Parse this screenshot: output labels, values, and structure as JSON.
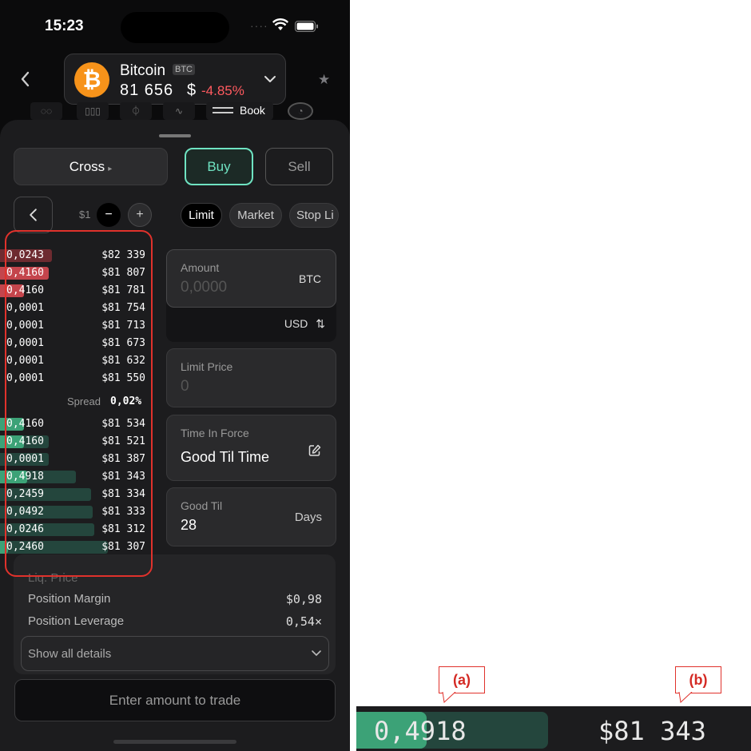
{
  "status": {
    "time": "15:23"
  },
  "coin": {
    "name": "Bitcoin",
    "symbol": "BTC",
    "price": "81 656",
    "currency": "$",
    "change": "-4.85%",
    "logo_glyph": "₿",
    "logo_color": "#f7931a"
  },
  "tabs": {
    "book_label": "Book"
  },
  "trade": {
    "margin_mode": "Cross",
    "buy_label": "Buy",
    "sell_label": "Sell",
    "step": "$1",
    "minus": "−",
    "plus": "+"
  },
  "order_types": [
    "Limit",
    "Market",
    "Stop Li"
  ],
  "orderbook": {
    "asks": [
      {
        "size": "0,0243",
        "price": "$82 339",
        "fill": 0.34,
        "strong": 0
      },
      {
        "size": "0,4160",
        "price": "$81 807",
        "fill": 0.32,
        "strong": 0.32
      },
      {
        "size": "0,4160",
        "price": "$81 781",
        "fill": 0.16,
        "strong": 0.16
      },
      {
        "size": "0,0001",
        "price": "$81 754",
        "fill": 0,
        "strong": 0
      },
      {
        "size": "0,0001",
        "price": "$81 713",
        "fill": 0,
        "strong": 0
      },
      {
        "size": "0,0001",
        "price": "$81 673",
        "fill": 0,
        "strong": 0
      },
      {
        "size": "0,0001",
        "price": "$81 632",
        "fill": 0,
        "strong": 0
      },
      {
        "size": "0,0001",
        "price": "$81 550",
        "fill": 0,
        "strong": 0
      }
    ],
    "spread_label": "Spread",
    "spread_value": "0,02%",
    "bids": [
      {
        "size": "0,4160",
        "price": "$81 534",
        "fill": 0.16,
        "strong": 0.16
      },
      {
        "size": "0,4160",
        "price": "$81 521",
        "fill": 0.32,
        "strong": 0.16
      },
      {
        "size": "0,0001",
        "price": "$81 387",
        "fill": 0.32,
        "strong": 0
      },
      {
        "size": "0,4918",
        "price": "$81 343",
        "fill": 0.5,
        "strong": 0.18
      },
      {
        "size": "0,2459",
        "price": "$81 334",
        "fill": 0.6,
        "strong": 0
      },
      {
        "size": "0,0492",
        "price": "$81 333",
        "fill": 0.61,
        "strong": 0
      },
      {
        "size": "0,0246",
        "price": "$81 312",
        "fill": 0.62,
        "strong": 0
      },
      {
        "size": "0,2460",
        "price": "$81 307",
        "fill": 0.71,
        "strong": 0.05
      }
    ]
  },
  "form": {
    "amount_label": "Amount",
    "amount_placeholder": "0,0000",
    "amount_unit": "BTC",
    "toggle_unit": "USD",
    "limit_label": "Limit Price",
    "limit_placeholder": "0",
    "tif_label": "Time In Force",
    "tif_value": "Good Til Time",
    "goodtil_label": "Good Til",
    "goodtil_value": "28",
    "goodtil_unit": "Days"
  },
  "details": {
    "liq_label": "Liq. Price",
    "margin_label": "Position Margin",
    "margin_value": "$0,98",
    "leverage_label": "Position Leverage",
    "leverage_value": "0,54×",
    "show_all": "Show all details"
  },
  "submit_label": "Enter amount to trade",
  "zoom": {
    "callout_a": "(a)",
    "callout_b": "(b)",
    "size": "0,4918",
    "price": "$81 343"
  },
  "colors": {
    "accent": "#6fe3c2",
    "negative": "#ff5a5f",
    "ask_bar": "#6e2b30",
    "bid_bar": "#24463d",
    "highlight": "#e0322c"
  }
}
